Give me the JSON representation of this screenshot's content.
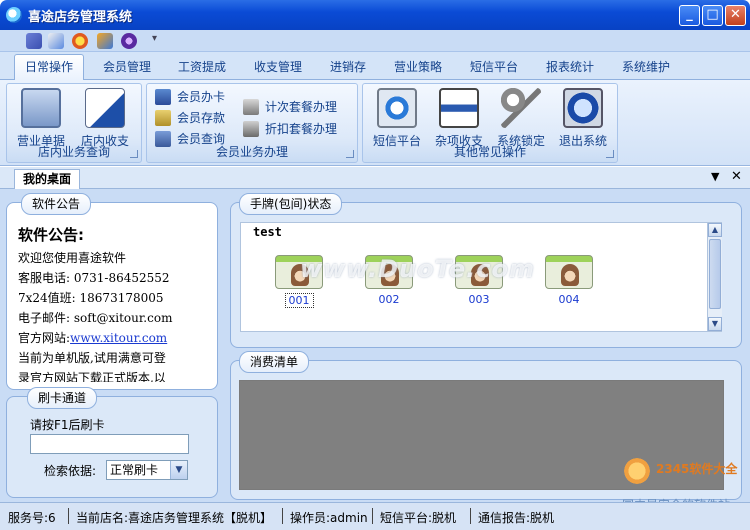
{
  "window": {
    "title": "喜途店务管理系统"
  },
  "tabs": [
    "日常操作",
    "会员管理",
    "工资提成",
    "收支管理",
    "进销存",
    "营业策略",
    "短信平台",
    "报表统计",
    "系统维护"
  ],
  "ribbon": {
    "group1": {
      "title": "店内业务查询",
      "buttons": [
        "营业单据",
        "店内收支"
      ]
    },
    "group2": {
      "title": "会员业务办理",
      "buttons": [
        "会员办卡",
        "会员存款",
        "会员查询",
        "计次套餐办理",
        "折扣套餐办理"
      ]
    },
    "group3": {
      "title": "其他常见操作",
      "buttons": [
        "短信平台",
        "杂项收支",
        "系统锁定",
        "退出系统"
      ]
    }
  },
  "doc": {
    "tab": "我的桌面"
  },
  "announcement": {
    "title": "软件公告",
    "heading": "软件公告:",
    "lines": [
      "欢迎您使用喜途软件",
      "客服电话: 0731-86452552",
      "7x24值班: 18673178005",
      "电子邮件: soft@xitour.com"
    ],
    "website_label": "官方网站:",
    "website_url": "www.xitour.com",
    "note_line1": "当前为单机版,试用满意可登",
    "note_line2": "录官方网站下载正式版本,以"
  },
  "card_status": {
    "title": "手牌(包间)状态",
    "group": "test",
    "cards": [
      "001",
      "002",
      "003",
      "004"
    ],
    "watermark": "www.DuoTe.com"
  },
  "consumption": {
    "title": "消费清单"
  },
  "card_channel": {
    "title": "刷卡通道",
    "prompt": "请按F1后刷卡",
    "search_label": "检索依据:",
    "search_value": "正常刷卡"
  },
  "logo": {
    "text1": "2345软件大全",
    "text2": "国内最安全的软件站"
  },
  "status": {
    "service": "服务号:6",
    "store": "当前店名:喜途店务管理系统【脱机】",
    "operator": "操作员:admin",
    "sms": "短信平台:脱机",
    "report": "通信报告:脱机"
  },
  "icons": {
    "quick_access": [
      "save-icon",
      "print-icon",
      "help-icon",
      "refresh-icon",
      "info-icon"
    ]
  }
}
